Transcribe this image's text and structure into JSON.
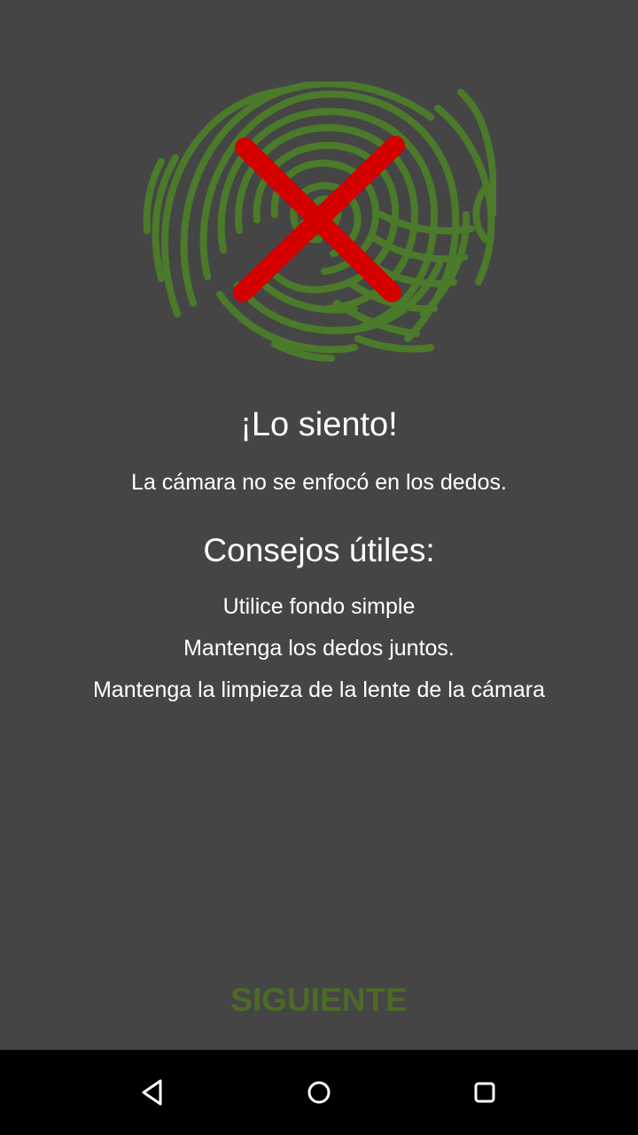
{
  "illustration": {
    "icon": "fingerprint-with-red-x",
    "fingerprint_color": "#4b7a2a",
    "cross_color": "#d40000"
  },
  "error": {
    "title": "¡Lo siento!",
    "message": "La cámara no se enfocó en los dedos."
  },
  "tips": {
    "heading": "Consejos útiles:",
    "items": [
      "Utilice fondo simple",
      "Mantenga los dedos juntos.",
      "Mantenga la limpieza de la lente de la cámara"
    ]
  },
  "actions": {
    "next_label": "SIGUIENTE",
    "next_color": "#4b6b25"
  },
  "navigation_bar": {
    "back_icon": "back-triangle-icon",
    "home_icon": "home-circle-icon",
    "recent_icon": "recent-apps-square-icon"
  }
}
